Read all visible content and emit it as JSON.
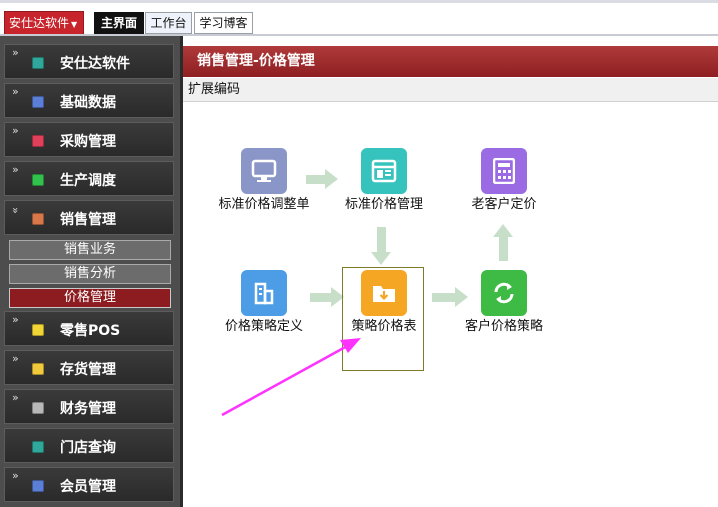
{
  "topbar": {
    "app_menu": "安仕达软件",
    "tabs": [
      "主界面",
      "工作台",
      "学习博客"
    ]
  },
  "sidebar": {
    "items": [
      {
        "label": "安仕达软件",
        "icon": "teal-cube-icon"
      },
      {
        "label": "基础数据",
        "icon": "blue-disk-icon"
      },
      {
        "label": "采购管理",
        "icon": "red-cart-icon"
      },
      {
        "label": "生产调度",
        "icon": "green-gear-icon"
      },
      {
        "label": "销售管理",
        "icon": "orange-box-icon"
      },
      {
        "label": "零售POS",
        "icon": "yellow-register-icon"
      },
      {
        "label": "存货管理",
        "icon": "yellow-folder-icon"
      },
      {
        "label": "财务管理",
        "icon": "gray-safe-icon"
      },
      {
        "label": "门店查询",
        "icon": "teal-store-icon"
      },
      {
        "label": "会员管理",
        "icon": "blue-card-icon"
      }
    ],
    "sales_submenu": [
      "销售业务",
      "销售分析",
      "价格管理"
    ],
    "active_sub": "价格管理"
  },
  "main": {
    "title": "销售管理-价格管理",
    "subheader": "扩展编码",
    "nodes": {
      "std_adjust": "标准价格调整单",
      "std_price": "标准价格管理",
      "old_customer": "老客户定价",
      "strategy_def": "价格策略定义",
      "strategy_table": "策略价格表",
      "customer_strategy": "客户价格策略"
    }
  },
  "colors": {
    "brand_red": "#c8242c",
    "header_red": "#9a2a2c",
    "active_sub": "#8c1c20",
    "arrow_green": "#c7dfc9",
    "annotation": "#ff33ff"
  }
}
